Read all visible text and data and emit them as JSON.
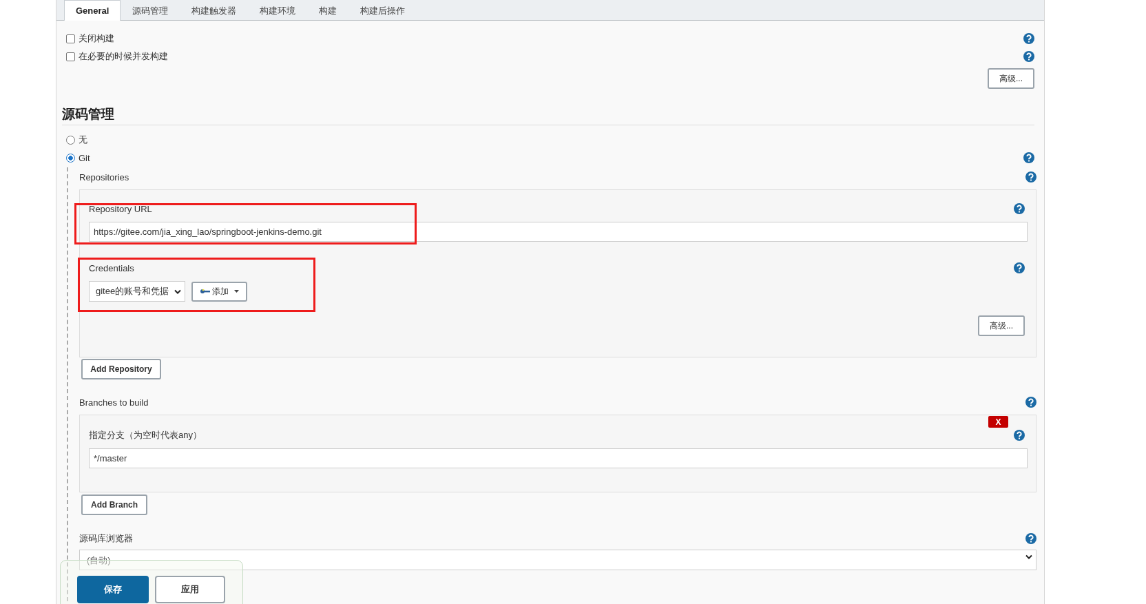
{
  "tabs": [
    {
      "label": "General",
      "selected": true
    },
    {
      "label": "源码管理",
      "selected": false
    },
    {
      "label": "构建触发器",
      "selected": false
    },
    {
      "label": "构建环境",
      "selected": false
    },
    {
      "label": "构建",
      "selected": false
    },
    {
      "label": "构建后操作",
      "selected": false
    }
  ],
  "general": {
    "options": [
      {
        "label": "关闭构建",
        "checked": false
      },
      {
        "label": "在必要的时候并发构建",
        "checked": false
      }
    ],
    "advanced_button": "高级..."
  },
  "scm": {
    "title": "源码管理",
    "options": [
      {
        "label": "无",
        "selected": false
      },
      {
        "label": "Git",
        "selected": true
      }
    ],
    "repositories_label": "Repositories",
    "repository_url": {
      "label": "Repository URL",
      "value": "https://gitee.com/jia_xing_lao/springboot-jenkins-demo.git"
    },
    "credentials": {
      "label": "Credentials",
      "value": "gitee的账号和凭据",
      "add_button": "添加"
    },
    "advanced_button": "高级...",
    "add_repository_button": "Add Repository",
    "branches_label": "Branches to build",
    "branch": {
      "delete_button": "X",
      "label": "指定分支（为空时代表any）",
      "value": "*/master"
    },
    "add_branch_button": "Add Branch",
    "browser": {
      "label": "源码库浏览器",
      "value": "(自动)"
    }
  },
  "footer": {
    "save_button": "保存",
    "apply_button": "应用"
  }
}
